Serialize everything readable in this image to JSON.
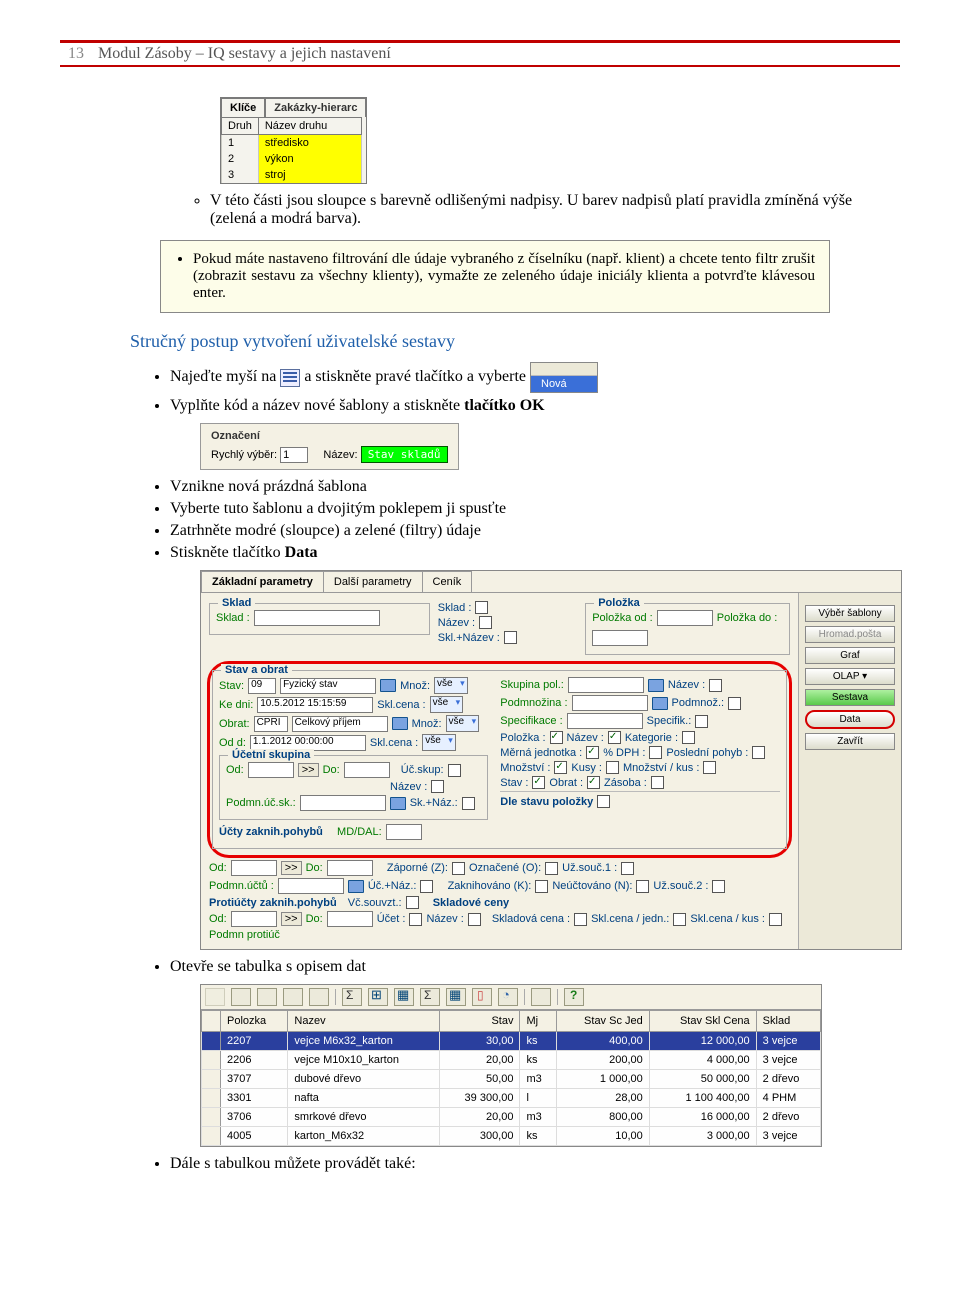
{
  "header": {
    "page_number": "13",
    "title": "Modul Zásoby – IQ sestavy a jejich nastavení"
  },
  "keys": {
    "tab_active": "Klíče",
    "tab_other": "Zakázky-hierarc",
    "col_druh": "Druh",
    "col_nazev": "Název druhu",
    "rows": [
      {
        "d": "1",
        "n": "středisko"
      },
      {
        "d": "2",
        "n": "výkon"
      },
      {
        "d": "3",
        "n": "stroj"
      }
    ]
  },
  "bullet_part_note": "V této části jsou sloupce s barevně odlišenými nadpisy. U barev nadpisů platí pravidla zmíněná výše (zelená a modrá barva).",
  "tip_text": "Pokud máte nastaveno filtrování dle údaje vybraného z číselníku (např. klient) a chcete tento filtr zrušit (zobrazit sestavu za všechny klienty), vymažte ze zeleného údaje iniciály klienta a potvrďte klávesou enter.",
  "section_head": "Stručný postup vytvoření uživatelské sestavy",
  "bul": {
    "hover_a": "Najeďte myší na ",
    "hover_b": " a stiskněte pravé tlačítko a vyberte  ",
    "nova": "Nová",
    "fill": "Vyplňte kód a název nové šablony a stiskněte ",
    "fill_bold": "tlačítko OK",
    "b1": "Vznikne nová prázdná šablona",
    "b2": "Vyberte tuto šablonu a dvojitým poklepem ji spusťte",
    "b3": "Zatrhněte modré (sloupce) a zelené (filtry) údaje",
    "b4_a": "Stiskněte tlačítko ",
    "b4_b": "Data",
    "b5": "Otevře se tabulka s opisem dat",
    "b6": "Dále s tabulkou můžete provádět také:"
  },
  "rychly": {
    "group": "Označení",
    "lbl_rychly": "Rychlý výběr:",
    "val_rychly": "1",
    "lbl_nazev": "Název:",
    "val_nazev": "Stav skladů"
  },
  "params": {
    "tabs": {
      "t1": "Základní parametry",
      "t2": "Další parametry",
      "t3": "Ceník"
    },
    "grp_sklad": "Sklad",
    "sklad_lbl": "Sklad :",
    "grp_stav": "Stav a obrat",
    "stav_lbl": "Stav:",
    "stav_code": "09",
    "stav_name": "Fyzický stav",
    "mnoz_lbl": "Množ:",
    "mnoz_val": "vše",
    "kedni_lbl": "Ke dni:",
    "kedni_val": "10.5.2012 15:15:59",
    "sklcena_lbl": "Skl.cena :",
    "sklcena_val": "vše",
    "obrat_lbl": "Obrat:",
    "obrat_code": "CPRI",
    "obrat_name": "Celkový příjem",
    "odd_lbl": "Od d:",
    "odd_val": "1.1.2012 00:00:00",
    "grp_ucet": "Účetní skupina",
    "od_lbl": "Od:",
    "do_lbl": "Do:",
    "arrow": ">>",
    "podmn_ucsk": "Podmn.úč.sk.:",
    "ucskup": "Úč.skup:",
    "nazev_s": "Název :",
    "sknaz": "Sk.+Náz.:",
    "grp_uctyzak": "Účty zaknih.pohybů",
    "mddal": "MD/DAL:",
    "podmn_uctu": "Podmn.účtů :",
    "ucet": "Účet :",
    "ucnaz": "Úč.+Náz.:",
    "grp_proti": "Protiúčty zaknih.pohybů",
    "vcsouvzt": "Vč.souvzt.:",
    "podmn_proti": "Podmn protiúč",
    "grp2_sklad_lbl": "Sklad :",
    "grp2_nazev": "Název :",
    "grp2_sklnazev": "Skl.+Název :",
    "grp_polozka": "Položka",
    "polod": "Položka od :",
    "poldo": "Položka do :",
    "skuppol": "Skupina pol.:",
    "podmnozina": "Podmnožina :",
    "specifikace": "Specifikace :",
    "specifik": "Specifik.:",
    "polozka": "Položka :",
    "nazev": "Název :",
    "kategorie": "Kategorie :",
    "merna": "Měrná jednotka :",
    "dph": "% DPH :",
    "poslpohyb": "Poslední pohyb :",
    "mnozstvi": "Množství :",
    "kusy": "Kusy :",
    "mnozkus": "Množství / kus :",
    "stav": "Stav :",
    "obrat": "Obrat :",
    "zasoba": "Zásoba :",
    "dlestavu": "Dle stavu položky",
    "zapornez": "Záporné (Z):",
    "ozn": "Označené (O):",
    "uz1": "Už.souč.1 :",
    "zaknih": "Zaknihováno (K):",
    "neuct": "Neúčtováno (N):",
    "uz2": "Už.souč.2 :",
    "grp_sklceny": "Skladové ceny",
    "sklcena": "Skladová cena :",
    "sklcenajedn": "Skl.cena / jedn.:",
    "sklcenakus": "Skl.cena / kus :",
    "side": {
      "vyber": "Výběr šablony",
      "hromad": "Hromad.pošta",
      "graf": "Graf",
      "olap": "OLAP",
      "sestava": "Sestava",
      "data": "Data",
      "zavrit": "Zavřít"
    }
  },
  "table": {
    "cols": [
      "Polozka",
      "Nazev",
      "Stav",
      "Mj",
      "Stav Sc Jed",
      "Stav Skl Cena",
      "Sklad"
    ],
    "rows": [
      {
        "p": "2207",
        "n": "vejce M6x32_karton",
        "s": "30,00",
        "m": "ks",
        "j": "400,00",
        "c": "12 000,00",
        "k": "3 vejce",
        "sel": true
      },
      {
        "p": "2206",
        "n": "vejce M10x10_karton",
        "s": "20,00",
        "m": "ks",
        "j": "200,00",
        "c": "4 000,00",
        "k": "3 vejce"
      },
      {
        "p": "3707",
        "n": "dubové dřevo",
        "s": "50,00",
        "m": "m3",
        "j": "1 000,00",
        "c": "50 000,00",
        "k": "2 dřevo"
      },
      {
        "p": "3301",
        "n": "nafta",
        "s": "39 300,00",
        "m": "l",
        "j": "28,00",
        "c": "1 100 400,00",
        "k": "4 PHM"
      },
      {
        "p": "3706",
        "n": "smrkové dřevo",
        "s": "20,00",
        "m": "m3",
        "j": "800,00",
        "c": "16 000,00",
        "k": "2 dřevo"
      },
      {
        "p": "4005",
        "n": "karton_M6x32",
        "s": "300,00",
        "m": "ks",
        "j": "10,00",
        "c": "3 000,00",
        "k": "3 vejce"
      }
    ]
  }
}
